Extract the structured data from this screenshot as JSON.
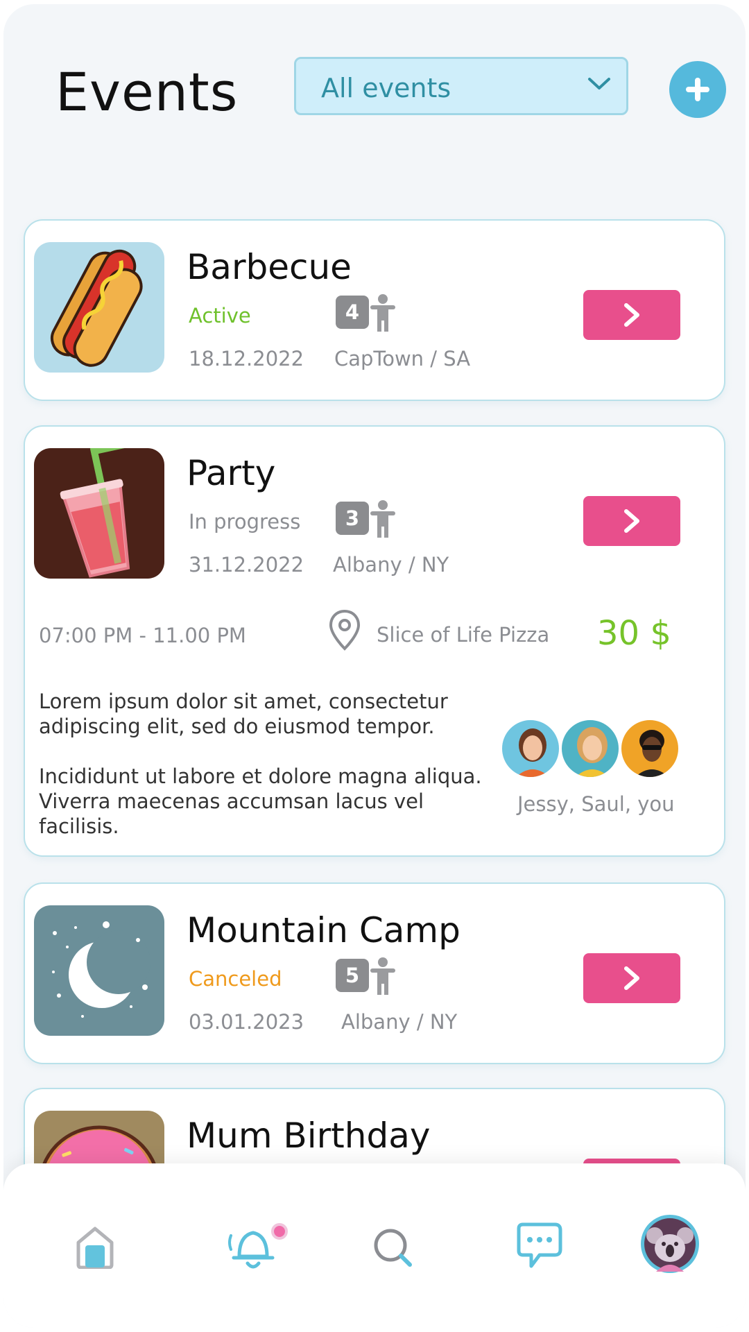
{
  "header": {
    "title": "Events",
    "filter": {
      "selected": "All events"
    }
  },
  "events": [
    {
      "name": "Barbecue",
      "status": "Active",
      "status_color": "#6fc12c",
      "participants": "4",
      "date": "18.12.2022",
      "location": "CapTown / SA",
      "icon": "hotdog-icon"
    },
    {
      "name": "Party",
      "status": "In progress",
      "status_color": "#8b8d92",
      "participants": "3",
      "date": "31.12.2022",
      "location": "Albany / NY",
      "icon": "drink-cup-icon",
      "time": "07:00 PM - 11.00 PM",
      "venue": "Slice of Life Pizza",
      "price": "30 $",
      "description": [
        "Lorem ipsum dolor sit amet, consectetur adipiscing elit,  sed do eiusmod tempor.",
        "Incididunt ut labore et dolore magna aliqua. Viverra maecenas accumsan lacus vel facilisis."
      ],
      "attendees": "Jessy, Saul, you"
    },
    {
      "name": "Mountain Camp",
      "status": "Canceled",
      "status_color": "#ef9a1c",
      "participants": "5",
      "date": "03.01.2023",
      "location": "Albany / NY",
      "icon": "moon-icon"
    },
    {
      "name": "Mum Birthday",
      "icon": "donut-icon"
    }
  ],
  "bottom_nav": [
    "home-icon",
    "bell-icon",
    "search-icon",
    "chat-icon",
    "profile-avatar"
  ],
  "colors": {
    "accent": "#55b9dc",
    "action": "#e84f8c",
    "price": "#76c32a"
  }
}
